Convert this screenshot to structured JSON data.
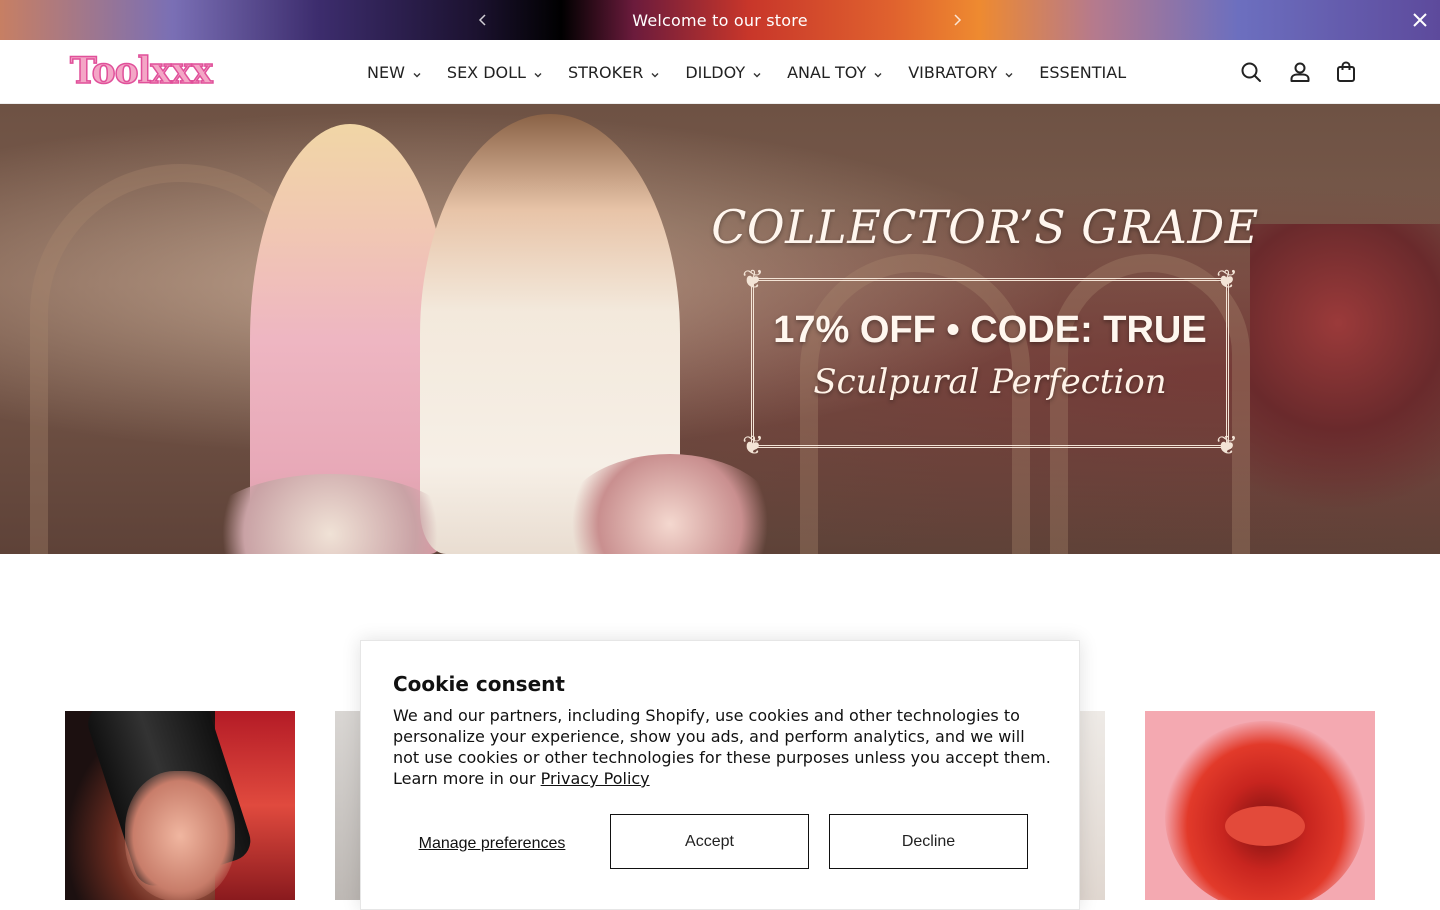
{
  "announcement": {
    "message": "Welcome to our store",
    "prev_icon": "chevron-left-icon",
    "next_icon": "chevron-right-icon",
    "close_icon": "close-icon"
  },
  "header": {
    "logo_text": "Toolxxx",
    "nav": [
      {
        "label": "NEW",
        "has_dropdown": true
      },
      {
        "label": "SEX DOLL",
        "has_dropdown": true
      },
      {
        "label": "STROKER",
        "has_dropdown": true
      },
      {
        "label": "DILDOY",
        "has_dropdown": true
      },
      {
        "label": "ANAL TOY",
        "has_dropdown": true
      },
      {
        "label": "VIBRATORY",
        "has_dropdown": true
      },
      {
        "label": "ESSENTIAL",
        "has_dropdown": false
      }
    ],
    "icons": [
      "search-icon",
      "account-icon",
      "cart-icon"
    ]
  },
  "hero": {
    "title": "COLLECTOR’S GRADE",
    "code_line": "17% OFF • CODE: TRUE",
    "script_line": "Sculpural Perfection"
  },
  "cookie": {
    "title": "Cookie consent",
    "body": "We and our partners, including Shopify, use cookies and other technologies to personalize your experience, show you ads, and perform analytics, and we will not use cookies or other technologies for these purposes unless you accept them. Learn more in our ",
    "privacy_link": "Privacy Policy",
    "manage_label": "Manage preferences",
    "accept_label": "Accept",
    "decline_label": "Decline"
  },
  "colors": {
    "logo_fill": "#f4a6c6",
    "logo_stroke": "#e0509a",
    "text": "#1a1a1a"
  }
}
